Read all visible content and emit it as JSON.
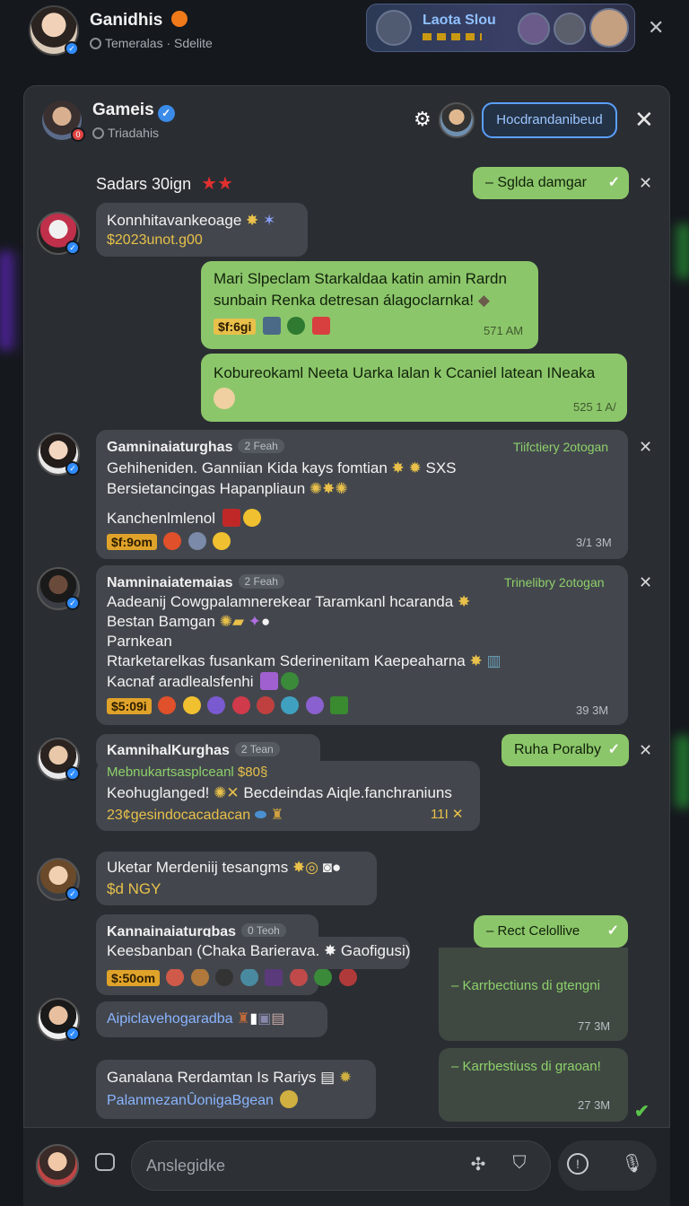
{
  "topbar": {
    "title": "Ganidhis",
    "subtitle": "Temeralas · Sdelite",
    "promo_title": "Laota Slou",
    "close": "✕"
  },
  "panel": {
    "title": "Gameis",
    "subtitle": "Triadahis",
    "header_button": "Hocdrandanibeud",
    "close": "✕",
    "gear": "⚙"
  },
  "section_title": "Sadars 30ign",
  "status_top": "–  Sglda damgar",
  "messages": [
    {
      "line1": "Konnhitavankeoage",
      "line2": "$2023unot.g00"
    },
    {
      "line1": "Mari Slpeclam Starkaldaa katin amin Rardn",
      "line2": "sunbain Renka detresan álagoclarnka!",
      "money": "$f:6gi",
      "time": "571 AM"
    },
    {
      "line1": "Kobureokaml Neeta Uarka lalan k Ccaniel latean INeaka",
      "time": "525 1 A/"
    },
    {
      "name": "Gamninaiaturghas",
      "tag": "2 Feah",
      "label": "Tiifctiery 2otogan",
      "line1": "Gehiheniden. Ganniian Kida kays fomtian",
      "line1_tail": "SXS",
      "line2": "Bersietancingas Hapanpliaun",
      "line3": "Kanchenlmlenol",
      "money": "$f:9om",
      "time": "3/1 3M"
    },
    {
      "name": "Namninaiatemaias",
      "tag": "2 Feah",
      "label": "Trinelibry 2otogan",
      "line1": "Aadeanij Cowgpalamnerekear Taramkanl hcaranda",
      "line2": "Bestan Bamgan",
      "line3": "Parnkean",
      "line4": "Rtarketarelkas fusankam Sderinenitam Kaepeaharna",
      "line5": "Kacnaf aradlealsfenhi",
      "money": "$5:09i",
      "time": "39 3M"
    },
    {
      "name": "KamnihalKurghas",
      "tag": "2 Tean",
      "line1": "Mebnukartsasplceanl",
      "line1_tail": "$80§",
      "line2": "Keohuglanged!",
      "line2_tail": "Becdeindas Aiqle.fanchraniuns",
      "line3": "23¢gesindocacadacan",
      "time": "11I"
    },
    {
      "line1": "Uketar Merdeniij tesangms",
      "line2": "$d NGY"
    },
    {
      "name": "Kannainaiaturgbas",
      "tag": "0 Teoh",
      "line1": "Keesbanban (Chaka Barierava.",
      "line1_tail": "Gaofigusi)",
      "money": "$:50om"
    },
    {
      "line1": "Aipiclavehogaradba"
    },
    {
      "line1": "Ganalana Rerdamtan Is Rariys",
      "line2": "PalanmezanÛonigaBgean"
    }
  ],
  "status_ruha": "Ruha Poralby",
  "status_right": [
    {
      "label": "–  Rect Celollive"
    },
    {
      "label": "–  Karrbectiuns di gtengni",
      "time": "77 3M"
    },
    {
      "label": "–  Karrbestiuss di graoan!",
      "time": "27 3M"
    }
  ],
  "composer": {
    "placeholder": "Anslegidke"
  },
  "colors": {
    "panel_bg": "#2a2d32",
    "bubble_dark": "#43474d",
    "bubble_green": "#8cc66a",
    "accent_blue": "#5aa0ff",
    "label_green": "#8ed06a",
    "gold": "#e8c04a"
  }
}
